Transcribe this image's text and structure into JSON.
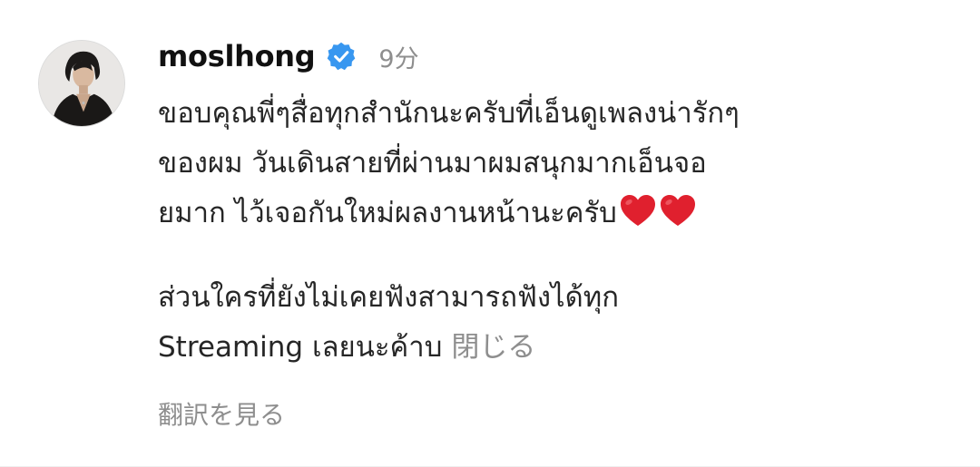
{
  "post": {
    "username": "moslhong",
    "verified": true,
    "time_ago": "9分",
    "caption_lines": [
      "ขอบคุณพี่ๆสื่อทุกสำนักนะครับที่เอ็นดูเพลงน่ารักๆ",
      "ของผม วันเดินสายที่ผ่านมาผมสนุกมากเอ็นจอ",
      "ยมาก ไว้เจอกันใหม่ผลงานหน้านะครับ",
      "ส่วนใครที่ยังไม่เคยฟังสามารถฟังได้ทุก",
      "Streaming เลยนะค้าบ"
    ],
    "close_label": "閉じる",
    "translate_label": "翻訳を見る"
  },
  "icons": {
    "verified": "verified-badge-icon",
    "heart": "red-heart-emoji"
  },
  "colors": {
    "verified_blue": "#3897f0",
    "muted_text": "#8e8e8e",
    "heart_red": "#e0202e"
  }
}
